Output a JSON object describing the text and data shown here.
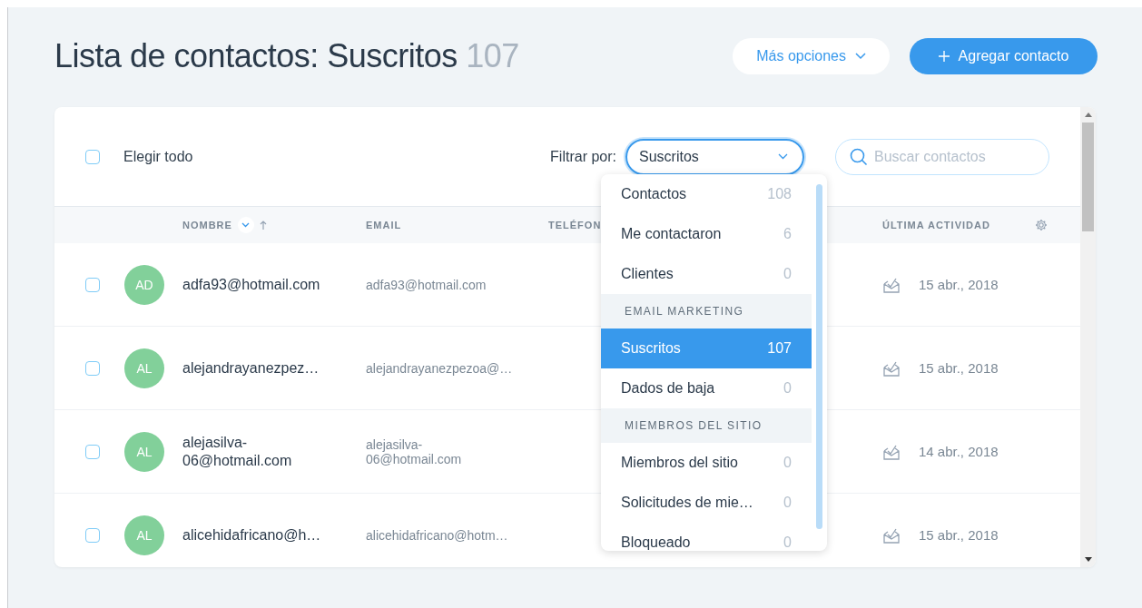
{
  "header": {
    "title": "Lista de contactos: Suscritos",
    "count": "107",
    "more_button": "Más opciones",
    "add_button": "Agregar contacto"
  },
  "toolbar": {
    "select_all": {
      "label": "Elegir todo",
      "checked": false
    },
    "filter_label": "Filtrar por:",
    "filter_value": "Suscritos",
    "search": {
      "placeholder": "Buscar contactos"
    }
  },
  "table": {
    "columns": [
      "NOMBRE",
      "EMAIL",
      "TELÉFON",
      "ÚLTIMA ACTIVIDAD"
    ],
    "rows": [
      {
        "checked": false,
        "initials": "AD",
        "name": "adfa93@hotmail.com",
        "email": "adfa93@hotmail.com",
        "last_activity": "15 abr., 2018"
      },
      {
        "checked": false,
        "initials": "AL",
        "name": "alejandrayanezpez…",
        "email": "alejandrayanezpezoa@…",
        "last_activity": "15 abr., 2018"
      },
      {
        "checked": false,
        "initials": "AL",
        "name": "alejasilva-06@hotmail.com",
        "email": "alejasilva-06@hotmail.com",
        "last_activity": "14 abr., 2018"
      },
      {
        "checked": false,
        "initials": "AL",
        "name": "alicehidafricano@h…",
        "email": "alicehidafricano@hotm…",
        "last_activity": "15 abr., 2018"
      }
    ]
  },
  "filter_menu": [
    {
      "kind": "item",
      "label": "Contactos",
      "count": "108",
      "selected": false
    },
    {
      "kind": "item",
      "label": "Me contactaron",
      "count": "6",
      "selected": false
    },
    {
      "kind": "item",
      "label": "Clientes",
      "count": "0",
      "selected": false
    },
    {
      "kind": "header",
      "label": "EMAIL MARKETING"
    },
    {
      "kind": "item",
      "label": "Suscritos",
      "count": "107",
      "selected": true
    },
    {
      "kind": "item",
      "label": "Dados de baja",
      "count": "0",
      "selected": false
    },
    {
      "kind": "header",
      "label": "MIEMBROS DEL SITIO"
    },
    {
      "kind": "item",
      "label": "Miembros del sitio",
      "count": "0",
      "selected": false
    },
    {
      "kind": "item",
      "label": "Solicitudes de mie…",
      "count": "0",
      "selected": false
    },
    {
      "kind": "item",
      "label": "Bloqueado",
      "count": "0",
      "selected": false
    }
  ]
}
